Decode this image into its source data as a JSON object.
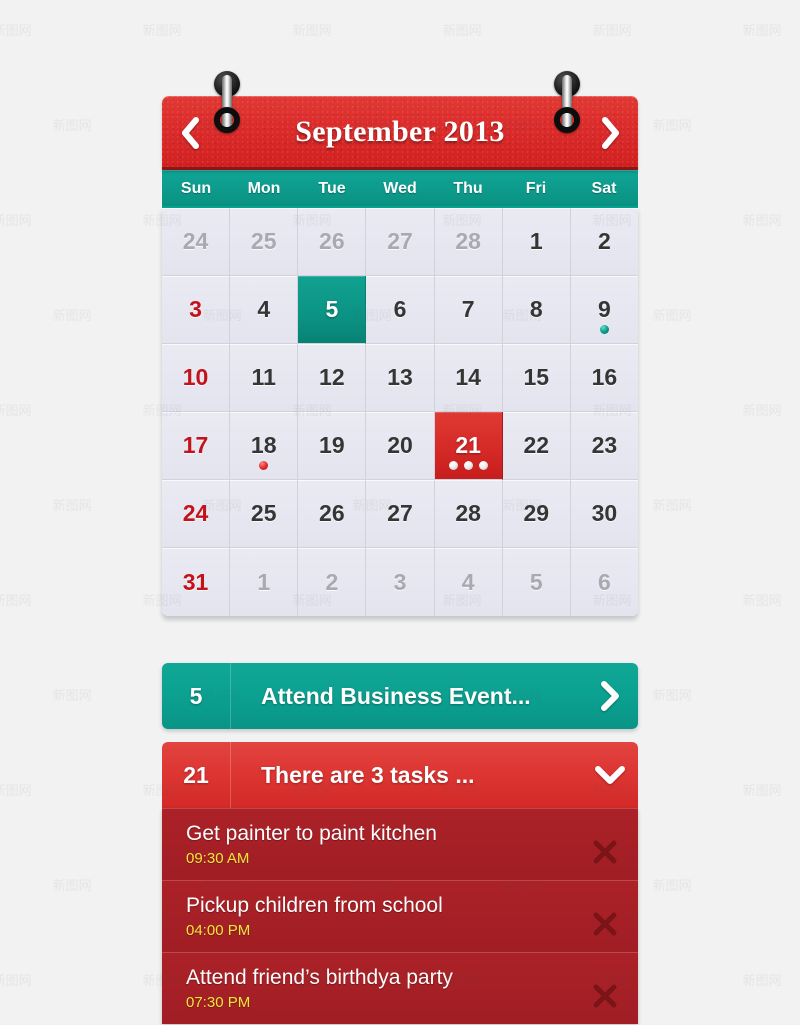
{
  "app": {
    "background_color": "#f2f2f2",
    "accent_red": "#d8232a",
    "accent_teal": "#0d9688",
    "task_panel_color": "#a42026",
    "task_time_color": "#f5e63a"
  },
  "header": {
    "month_title": "September 2013",
    "prev_icon": "chevron-left-icon",
    "next_icon": "chevron-right-icon",
    "background_color": "#d8232a"
  },
  "weekdays": [
    "Sun",
    "Mon",
    "Tue",
    "Wed",
    "Thu",
    "Fri",
    "Sat"
  ],
  "grid": {
    "weeks": [
      [
        {
          "label": "24",
          "state": "muted"
        },
        {
          "label": "25",
          "state": "muted"
        },
        {
          "label": "26",
          "state": "muted"
        },
        {
          "label": "27",
          "state": "muted"
        },
        {
          "label": "28",
          "state": "muted"
        },
        {
          "label": "1",
          "state": "normal"
        },
        {
          "label": "2",
          "state": "normal"
        }
      ],
      [
        {
          "label": "3",
          "state": "sunday"
        },
        {
          "label": "4",
          "state": "normal"
        },
        {
          "label": "5",
          "state": "selected-teal"
        },
        {
          "label": "6",
          "state": "normal"
        },
        {
          "label": "7",
          "state": "normal"
        },
        {
          "label": "8",
          "state": "normal"
        },
        {
          "label": "9",
          "state": "normal",
          "dots": [
            "teal"
          ]
        }
      ],
      [
        {
          "label": "10",
          "state": "sunday"
        },
        {
          "label": "11",
          "state": "normal"
        },
        {
          "label": "12",
          "state": "normal"
        },
        {
          "label": "13",
          "state": "normal"
        },
        {
          "label": "14",
          "state": "normal"
        },
        {
          "label": "15",
          "state": "normal"
        },
        {
          "label": "16",
          "state": "normal"
        }
      ],
      [
        {
          "label": "17",
          "state": "sunday"
        },
        {
          "label": "18",
          "state": "normal",
          "dots": [
            "red"
          ]
        },
        {
          "label": "19",
          "state": "normal"
        },
        {
          "label": "20",
          "state": "normal"
        },
        {
          "label": "21",
          "state": "selected-red",
          "dots": [
            "white",
            "white",
            "white"
          ]
        },
        {
          "label": "22",
          "state": "normal"
        },
        {
          "label": "23",
          "state": "normal"
        }
      ],
      [
        {
          "label": "24",
          "state": "sunday"
        },
        {
          "label": "25",
          "state": "normal"
        },
        {
          "label": "26",
          "state": "normal"
        },
        {
          "label": "27",
          "state": "normal"
        },
        {
          "label": "28",
          "state": "normal"
        },
        {
          "label": "29",
          "state": "normal"
        },
        {
          "label": "30",
          "state": "normal"
        }
      ],
      [
        {
          "label": "31",
          "state": "sunday"
        },
        {
          "label": "1",
          "state": "muted"
        },
        {
          "label": "2",
          "state": "muted"
        },
        {
          "label": "3",
          "state": "muted"
        },
        {
          "label": "4",
          "state": "muted"
        },
        {
          "label": "5",
          "state": "muted"
        },
        {
          "label": "6",
          "state": "muted"
        }
      ]
    ]
  },
  "events": [
    {
      "day": "5",
      "title": "Attend Business Event...",
      "color": "#0ca291",
      "chevron": "chevron-right-icon"
    },
    {
      "day": "21",
      "title": "There are 3 tasks ...",
      "color": "#dd3633",
      "chevron": "chevron-down-icon"
    }
  ],
  "tasks": [
    {
      "title": "Get painter to paint kitchen",
      "time": "09:30 AM",
      "delete_icon": "close-x-icon"
    },
    {
      "title": "Pickup children from school",
      "time": "04:00 PM",
      "delete_icon": "close-x-icon"
    },
    {
      "title": "Attend friend’s birthdya party",
      "time": "07:30 PM",
      "delete_icon": "close-x-icon"
    }
  ],
  "watermark": {
    "text": "新图网"
  }
}
